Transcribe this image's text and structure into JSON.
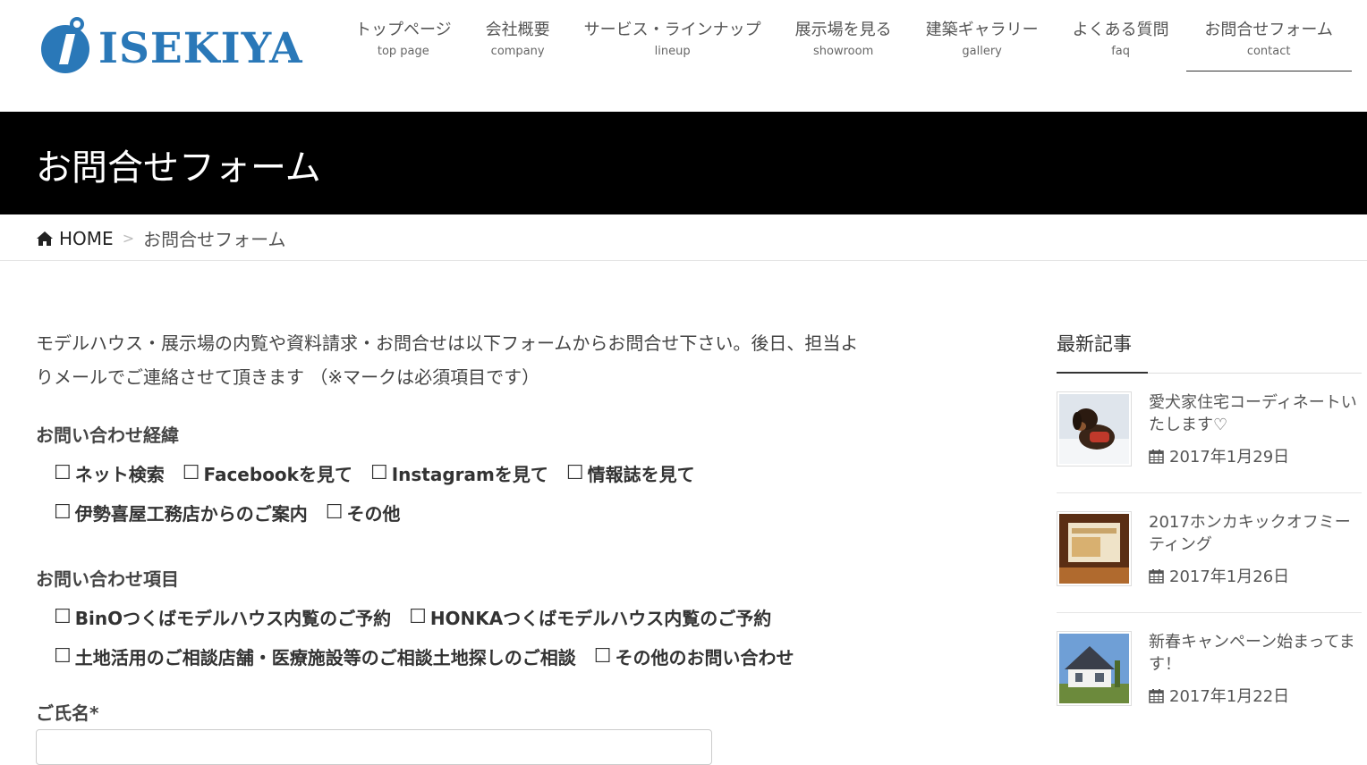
{
  "header": {
    "logo_text": "ISEKIYA",
    "nav": [
      {
        "ja": "トップページ",
        "en": "top page"
      },
      {
        "ja": "会社概要",
        "en": "company"
      },
      {
        "ja": "サービス・ラインナップ",
        "en": "lineup"
      },
      {
        "ja": "展示場を見る",
        "en": "showroom"
      },
      {
        "ja": "建築ギャラリー",
        "en": "gallery"
      },
      {
        "ja": "よくある質問",
        "en": "faq"
      },
      {
        "ja": "お問合せフォーム",
        "en": "contact"
      }
    ],
    "active_nav": "contact"
  },
  "page_title": "お問合せフォーム",
  "breadcrumb": {
    "home": "HOME",
    "separator": ">",
    "current": "お問合せフォーム"
  },
  "form": {
    "intro_line1": "モデルハウス・展示場の内覧や資料請求・お問合せは以下フォームからお問合せ下さい。後日、担当よ",
    "intro_line2": "りメールでご連絡させて頂きます （※マークは必須項目です）",
    "checkbox_glyph": "☐",
    "source_group": {
      "title": "お問い合わせ経緯",
      "rows": [
        [
          "ネット検索",
          "Facebookを見て",
          "Instagramを見て",
          "情報誌を見て"
        ],
        [
          "伊勢喜屋工務店からのご案内",
          "その他"
        ]
      ]
    },
    "topic_group": {
      "title": "お問い合わせ項目",
      "rows": [
        [
          "BinOつくばモデルハウス内覧のご予約",
          "HONKAつくばモデルハウス内覧のご予約"
        ],
        [
          "土地活用のご相談店舗・医療施設等のご相談土地探しのご相談",
          "その他のお問い合わせ"
        ]
      ]
    },
    "name_label": "ご氏名*",
    "name_value": ""
  },
  "sidebar": {
    "title": "最新記事",
    "posts": [
      {
        "title": "愛犬家住宅コーディネートいたします♡",
        "date": "2017年1月29日"
      },
      {
        "title": "2017ホンカキックオフミーティング",
        "date": "2017年1月26日"
      },
      {
        "title": "新春キャンペーン始まってます！",
        "date": "2017年1月22日"
      }
    ]
  },
  "colors": {
    "brand_blue": "#2a78b8",
    "title_bar_bg": "#000000",
    "text": "#333333"
  }
}
